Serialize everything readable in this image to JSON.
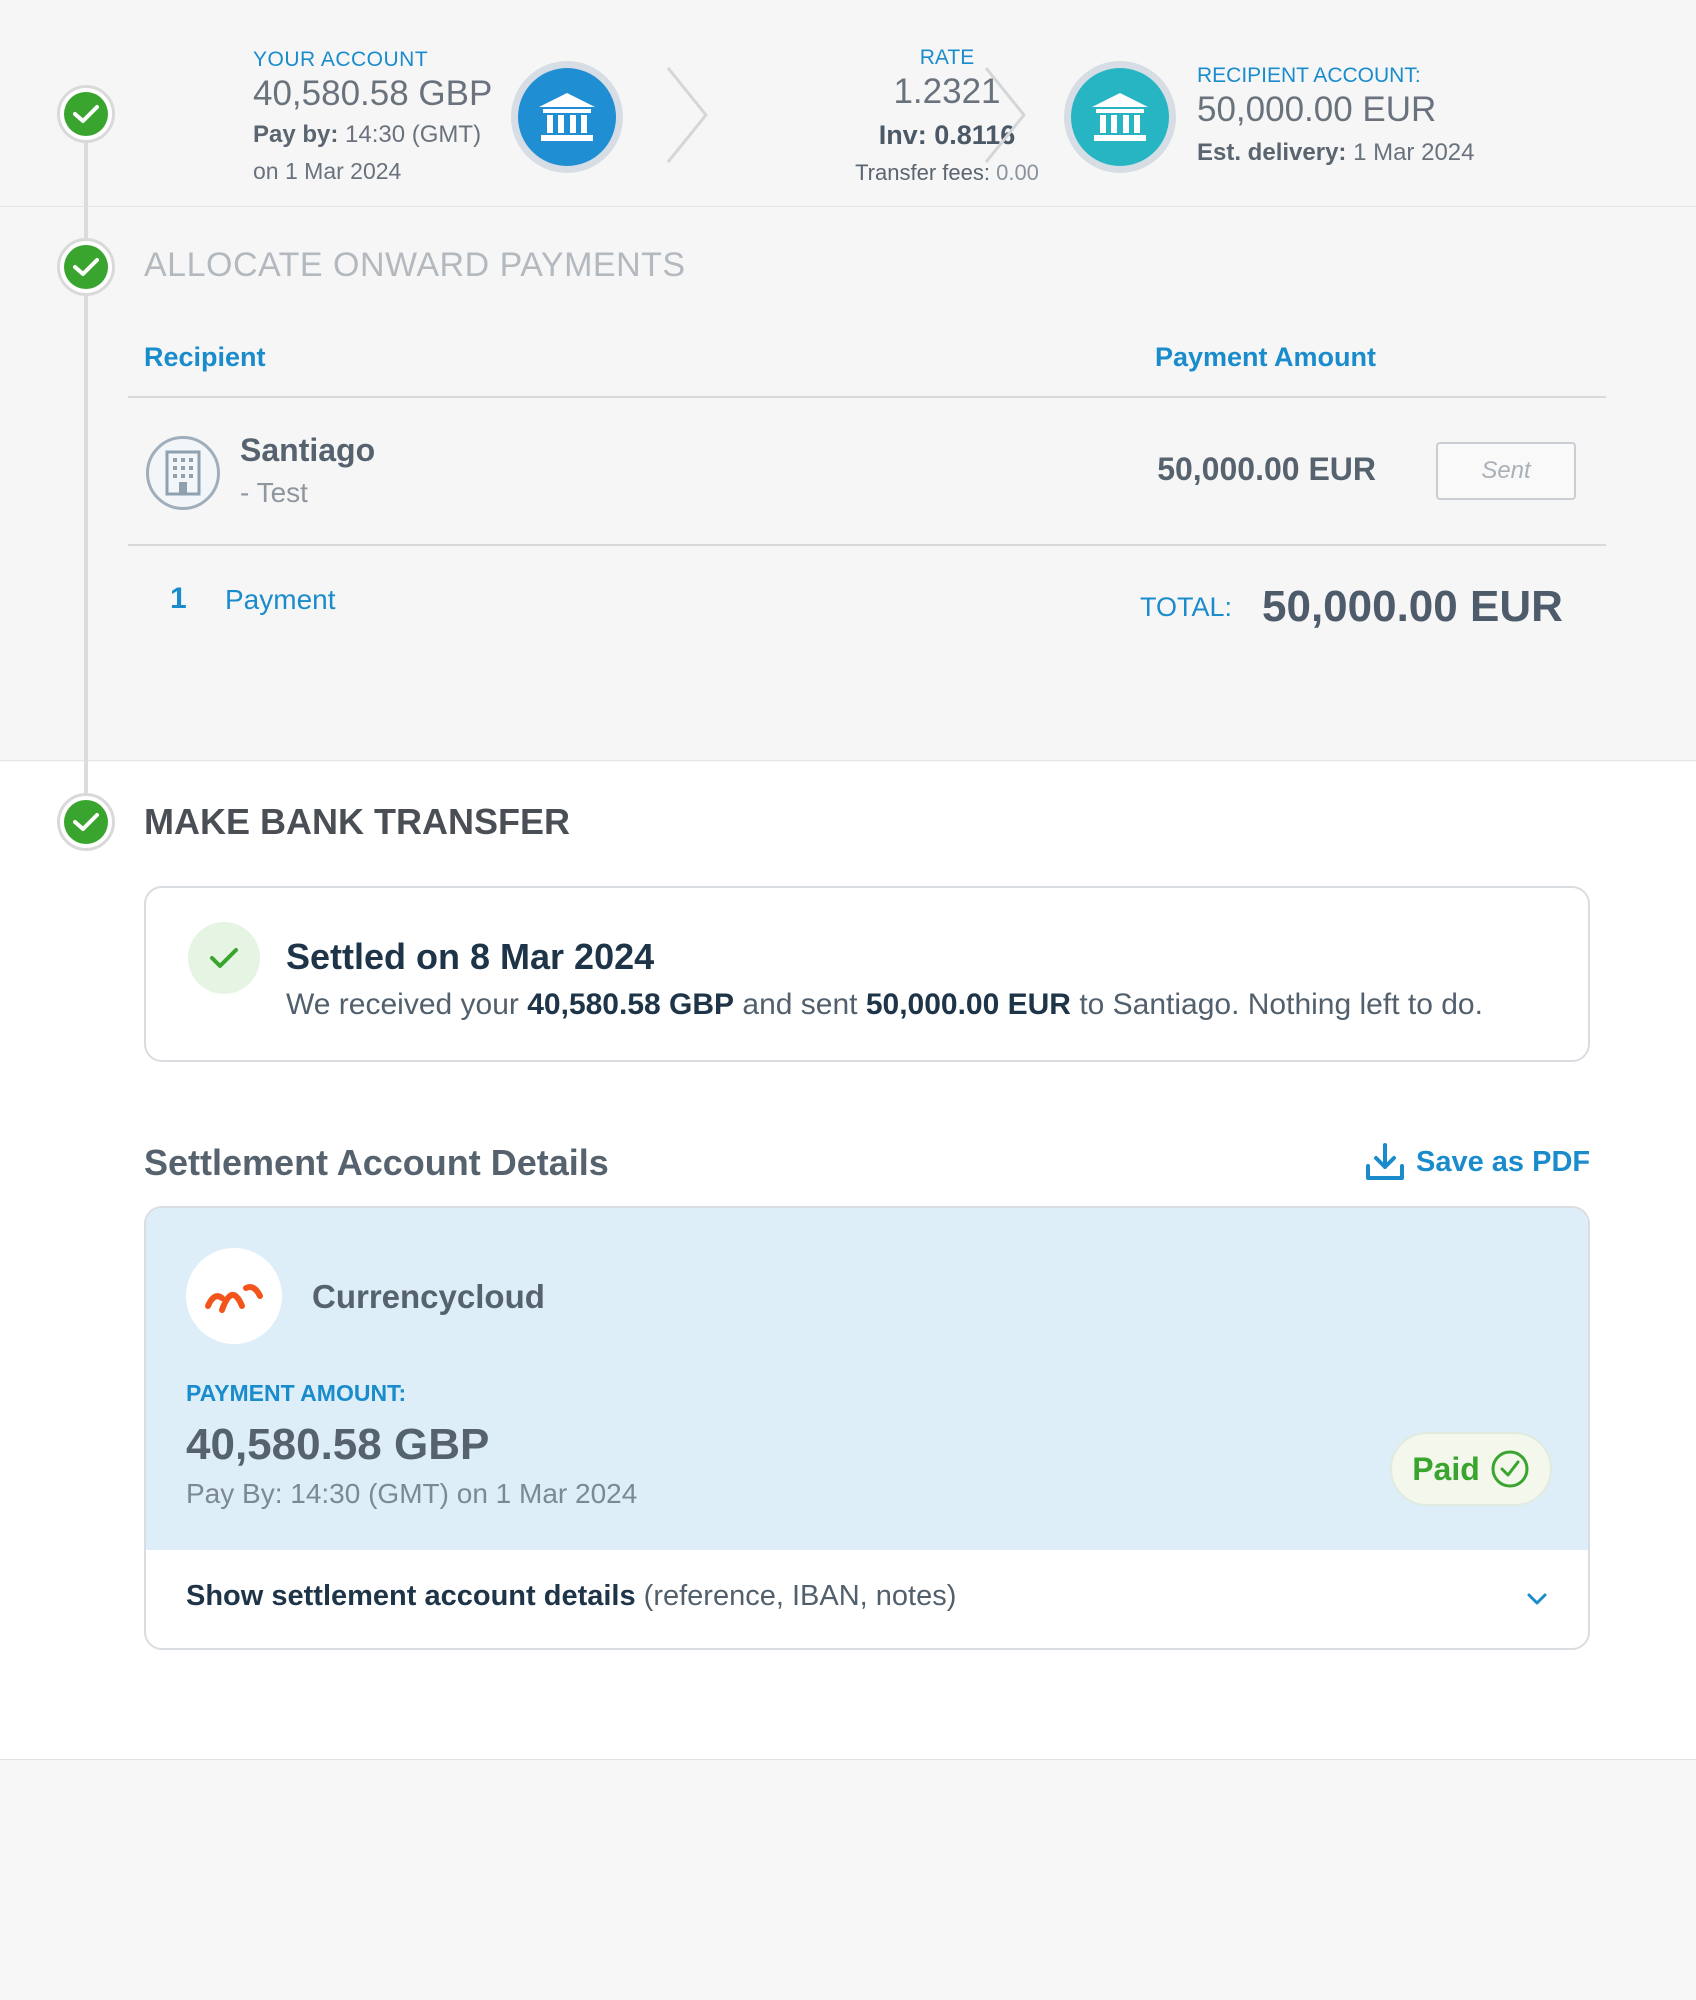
{
  "summary": {
    "your_account_label": "YOUR ACCOUNT",
    "your_account_amount": "40,580.58 GBP",
    "pay_by_label": "Pay by:",
    "pay_by_time": "14:30 (GMT)",
    "pay_by_date": "on 1 Mar 2024",
    "rate_label": "RATE",
    "rate_value": "1.2321",
    "inv_label": "Inv:",
    "inv_value": "0.8116",
    "fees_label": "Transfer fees:",
    "fees_value": "0.00",
    "recipient_account_label": "RECIPIENT ACCOUNT:",
    "recipient_account_amount": "50,000.00 EUR",
    "est_delivery_label": "Est. delivery:",
    "est_delivery_date": "1 Mar 2024"
  },
  "allocate": {
    "title": "ALLOCATE ONWARD PAYMENTS",
    "col_recipient": "Recipient",
    "col_amount": "Payment Amount",
    "rows": [
      {
        "name": "Santiago",
        "subtitle": "- Test",
        "amount": "50,000.00 EUR",
        "status": "Sent"
      }
    ],
    "count": "1",
    "count_label": "Payment",
    "total_label": "TOTAL:",
    "total_value": "50,000.00 EUR"
  },
  "transfer": {
    "title": "MAKE BANK TRANSFER",
    "settled_title": "Settled on 8 Mar 2024",
    "msg_pre": "We received your",
    "msg_amount_in": "40,580.58 GBP",
    "msg_mid": "and sent",
    "msg_amount_out": "50,000.00 EUR",
    "msg_post": "to Santiago. Nothing left to do.",
    "details_title": "Settlement Account Details",
    "save_pdf": "Save as PDF",
    "provider": "Currencycloud",
    "payment_amount_label": "PAYMENT AMOUNT:",
    "payment_amount": "40,580.58 GBP",
    "pay_by_line": "Pay By: 14:30 (GMT) on 1 Mar 2024",
    "paid_label": "Paid",
    "show_details": "Show settlement account details",
    "show_details_hint": "(reference, IBAN, notes)"
  },
  "colors": {
    "accent_blue": "#1a8ccc",
    "success_green": "#39a52f",
    "bank_blue": "#1f8ed3",
    "bank_teal": "#27b5c4",
    "cc_orange": "#f2541b"
  }
}
